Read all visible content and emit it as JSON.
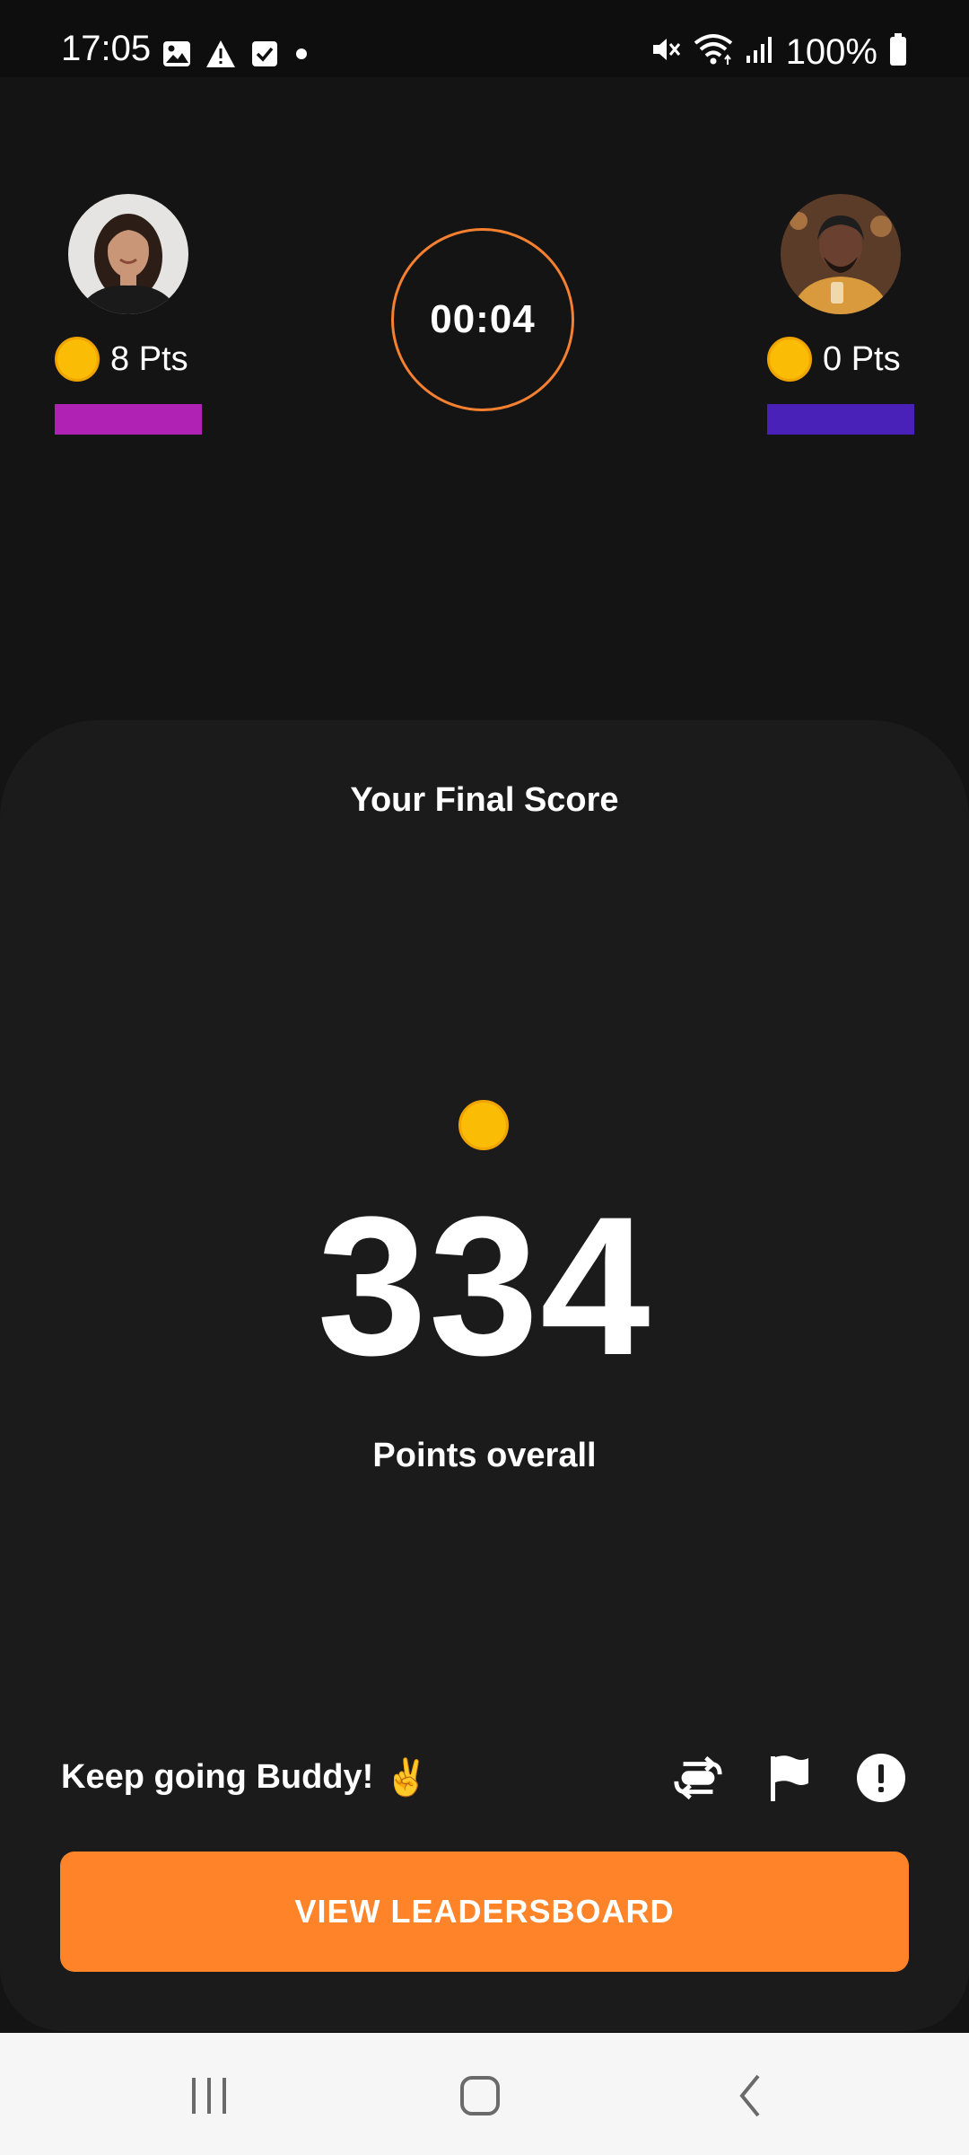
{
  "status_bar": {
    "time": "17:05",
    "left_icons": [
      "gallery-icon",
      "warning-icon",
      "checkbox-icon",
      "dot-icon"
    ],
    "right_icons": [
      "mute-icon",
      "wifi-icon",
      "signal-icon",
      "battery-icon"
    ],
    "battery_percent": "100%"
  },
  "players": [
    {
      "avatar": "avatar-woman",
      "points": "8 Pts",
      "bar_color": "#b022b4"
    },
    {
      "avatar": "avatar-man",
      "points": "0 Pts",
      "bar_color": "#4a21b8"
    }
  ],
  "timer": {
    "value": "00:04",
    "ring_color": "#f58030"
  },
  "result": {
    "title": "Your Final Score",
    "score": "334",
    "caption": "Points overall"
  },
  "footer": {
    "message": "Keep going Buddy!",
    "emoji": "✌️",
    "action_icons": [
      "repeat-icon",
      "flag-icon",
      "info-icon"
    ],
    "leaderboard_label": "VIEW LEADERSBOARD",
    "leaderboard_color": "#fe8329"
  },
  "nav_bar": {
    "buttons": [
      "recents-icon",
      "home-icon",
      "back-icon"
    ]
  },
  "colors": {
    "background": "#141414",
    "card": "#1b1b1b",
    "coin": "#fbbc05",
    "accent": "#fe8329"
  }
}
